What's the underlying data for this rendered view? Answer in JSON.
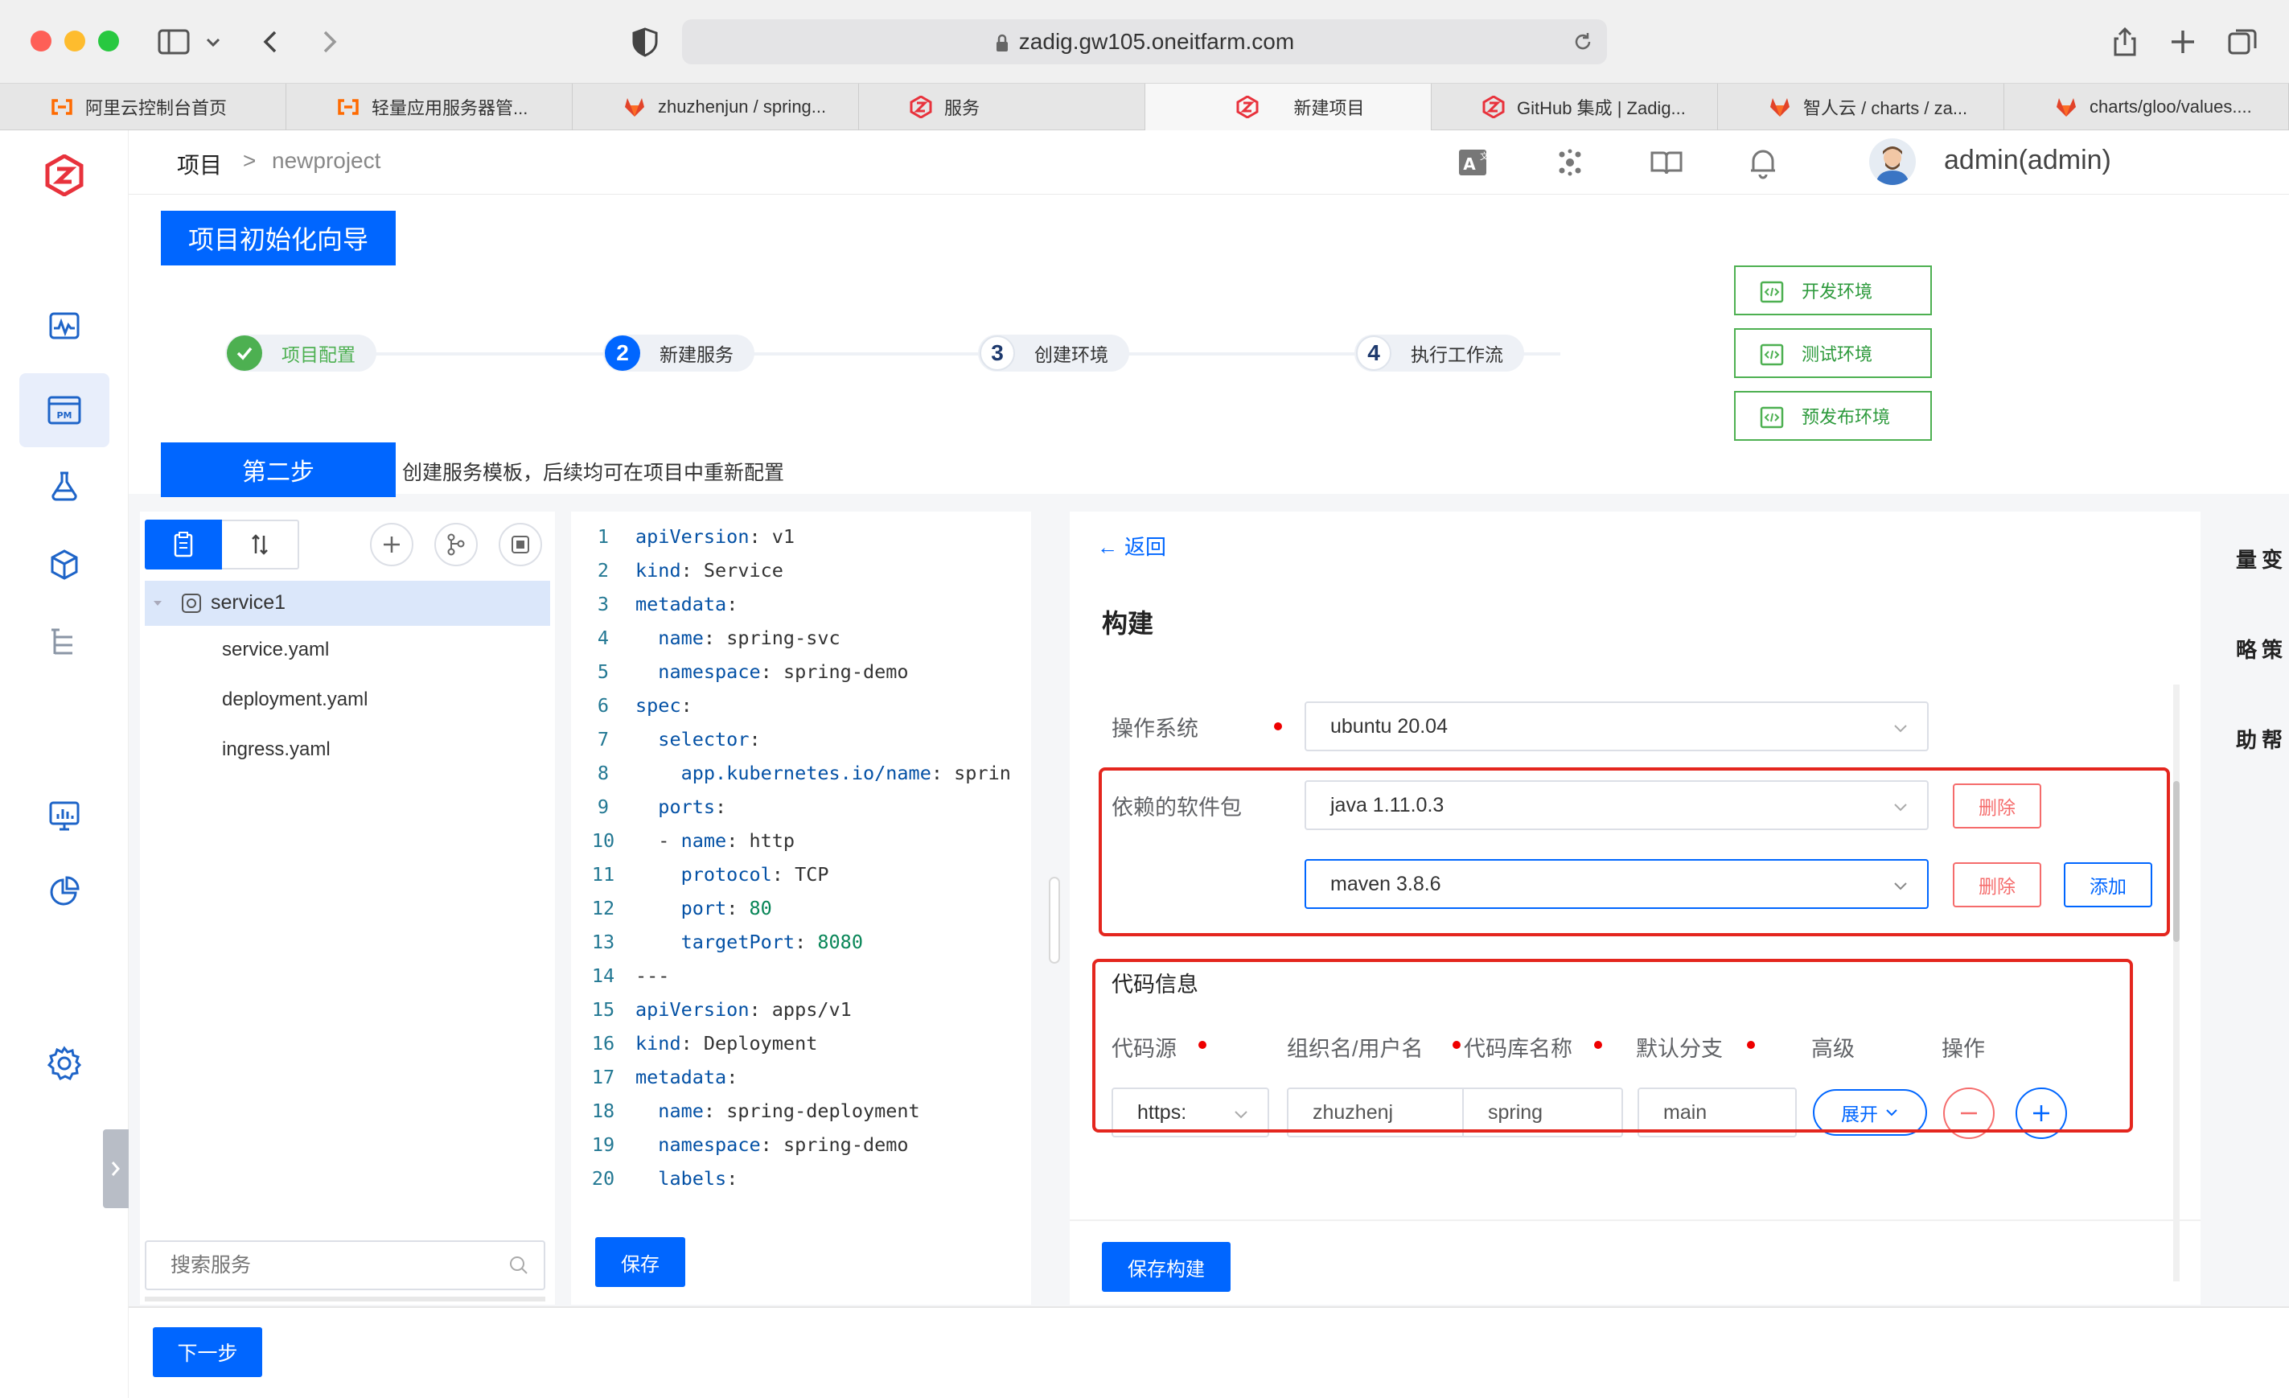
{
  "browser": {
    "url": "zadig.gw105.oneitfarm.com",
    "tabs": [
      {
        "label": "阿里云控制台首页",
        "icon": "aliyun-icon",
        "active": false
      },
      {
        "label": "轻量应用服务器管...",
        "icon": "aliyun-icon",
        "active": false
      },
      {
        "label": "zhuzhenjun / spring...",
        "icon": "gitlab-icon",
        "active": false
      },
      {
        "label": "服务",
        "icon": "zadig-icon",
        "active": false
      },
      {
        "label": "新建项目",
        "icon": "zadig-icon",
        "active": true
      },
      {
        "label": "GitHub 集成 | Zadig...",
        "icon": "zadig-icon",
        "active": false
      },
      {
        "label": "智人云 / charts / za...",
        "icon": "gitlab-icon",
        "active": false
      },
      {
        "label": "charts/gloo/values....",
        "icon": "gitlab-icon",
        "active": false
      }
    ]
  },
  "header": {
    "breadcrumb_root": "项目",
    "breadcrumb_sep": ">",
    "breadcrumb_current": "newproject",
    "user": "admin(admin)"
  },
  "wizard": {
    "title": "项目初始化向导",
    "steps": [
      {
        "num": "",
        "label": "项目配置",
        "state": "done"
      },
      {
        "num": "2",
        "label": "新建服务",
        "state": "current"
      },
      {
        "num": "3",
        "label": "创建环境",
        "state": "todo"
      },
      {
        "num": "4",
        "label": "执行工作流",
        "state": "todo"
      }
    ],
    "envs": [
      "开发环境",
      "测试环境",
      "预发布环境"
    ],
    "step_tag": "第二步",
    "step_desc": "创建服务模板，后续均可在项目中重新配置"
  },
  "service_tree": {
    "root": "service1",
    "files": [
      "service.yaml",
      "deployment.yaml",
      "ingress.yaml"
    ],
    "search_placeholder": "搜索服务"
  },
  "editor": {
    "lines": [
      {
        "n": "1",
        "indent": "",
        "key": "apiVersion",
        "val": "v1"
      },
      {
        "n": "2",
        "indent": "",
        "key": "kind",
        "val": "Service"
      },
      {
        "n": "3",
        "indent": "",
        "key": "metadata",
        "val": ""
      },
      {
        "n": "4",
        "indent": "  ",
        "key": "name",
        "val": "spring-svc"
      },
      {
        "n": "5",
        "indent": "  ",
        "key": "namespace",
        "val": "spring-demo"
      },
      {
        "n": "6",
        "indent": "",
        "key": "spec",
        "val": ""
      },
      {
        "n": "7",
        "indent": "  ",
        "key": "selector",
        "val": ""
      },
      {
        "n": "8",
        "indent": "    ",
        "key": "app.kubernetes.io/name",
        "val": "sprin"
      },
      {
        "n": "9",
        "indent": "  ",
        "key": "ports",
        "val": ""
      },
      {
        "n": "10",
        "indent": "  - ",
        "key": "name",
        "val": "http"
      },
      {
        "n": "11",
        "indent": "    ",
        "key": "protocol",
        "val": "TCP"
      },
      {
        "n": "12",
        "indent": "    ",
        "key": "port",
        "val": "80",
        "num": true
      },
      {
        "n": "13",
        "indent": "    ",
        "key": "targetPort",
        "val": "8080",
        "num": true
      },
      {
        "n": "14",
        "indent": "",
        "key": "",
        "val": "---"
      },
      {
        "n": "15",
        "indent": "",
        "key": "apiVersion",
        "val": "apps/v1"
      },
      {
        "n": "16",
        "indent": "",
        "key": "kind",
        "val": "Deployment"
      },
      {
        "n": "17",
        "indent": "",
        "key": "metadata",
        "val": ""
      },
      {
        "n": "18",
        "indent": "  ",
        "key": "name",
        "val": "spring-deployment"
      },
      {
        "n": "19",
        "indent": "  ",
        "key": "namespace",
        "val": "spring-demo"
      },
      {
        "n": "20",
        "indent": "  ",
        "key": "labels",
        "val": ""
      }
    ],
    "save_label": "保存"
  },
  "build": {
    "back_label": "返回",
    "title": "构建",
    "os_label": "操作系统",
    "os_value": "ubuntu 20.04",
    "deps_label": "依赖的软件包",
    "deps": [
      "java 1.11.0.3",
      "maven 3.8.6"
    ],
    "delete_label": "删除",
    "add_label": "添加",
    "code_title": "代码信息",
    "code_cols": [
      "代码源",
      "组织名/用户名",
      "代码库名称",
      "默认分支",
      "高级",
      "操作"
    ],
    "code_source": "https:",
    "org": "zhuzhenj",
    "repo": "spring",
    "branch": "main",
    "expand_label": "展开",
    "save_build_label": "保存构建"
  },
  "side_text": [
    "量变",
    "略策",
    "助帮"
  ],
  "footer": {
    "next_label": "下一步"
  },
  "colors": {
    "primary": "#0066ff",
    "danger": "#f56c6c",
    "success": "#4db051",
    "highlight": "#e4261e"
  }
}
